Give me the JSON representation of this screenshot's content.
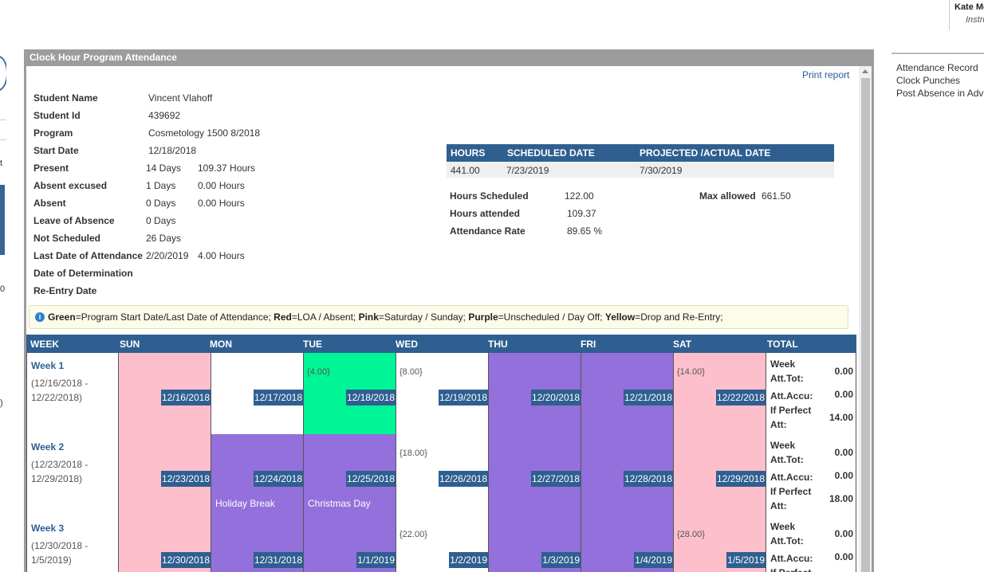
{
  "user": {
    "name": "Kate Mc",
    "role": "Instru"
  },
  "left_chars": [
    "t",
    "0",
    ")",
    "0"
  ],
  "panel": {
    "title": "Clock Hour Program Attendance",
    "print_label": "Print report"
  },
  "student": {
    "rows": [
      {
        "label": "Student Name",
        "value": "Vincent Vlahoff"
      },
      {
        "label": "Student Id",
        "value": "439692"
      },
      {
        "label": "Program",
        "value": "Cosmetology 1500 8/2018"
      },
      {
        "label": "Start Date",
        "value": "12/18/2018"
      },
      {
        "label": "Present",
        "days": "14 Days",
        "hours": "109.37 Hours"
      },
      {
        "label": "Absent excused",
        "days": "1 Days",
        "hours": "0.00 Hours"
      },
      {
        "label": "Absent",
        "days": "0 Days",
        "hours": "0.00 Hours"
      },
      {
        "label": "Leave of Absence",
        "days": "0 Days"
      },
      {
        "label": "Not Scheduled",
        "days": "26 Days"
      },
      {
        "label": "Last Date of Attendance",
        "value": "2/20/2019",
        "hours": "4.00 Hours"
      },
      {
        "label": "Date of Determination"
      },
      {
        "label": "Re-Entry Date"
      }
    ]
  },
  "projection": {
    "headers": [
      "HOURS",
      "SCHEDULED DATE",
      "PROJECTED /ACTUAL DATE"
    ],
    "row": [
      "441.00",
      "7/23/2019",
      "7/30/2019"
    ]
  },
  "stats": {
    "hours_scheduled_label": "Hours Scheduled",
    "hours_scheduled": "122.00",
    "hours_attended_label": "Hours attended",
    "hours_attended": "109.37",
    "attendance_rate_label": "Attendance Rate",
    "attendance_rate": "89.65 %",
    "max_allowed_label": "Max allowed",
    "max_allowed": "661.50"
  },
  "legend": {
    "parts": [
      {
        "b": "Green",
        "t": "=Program Start Date/Last Date of Attendance; "
      },
      {
        "b": "Red",
        "t": "=LOA / Absent; "
      },
      {
        "b": "Pink",
        "t": "=Saturday / Sunday; "
      },
      {
        "b": "Purple",
        "t": "=Unscheduled / Day Off; "
      },
      {
        "b": "Yellow",
        "t": "=Drop and Re-Entry;"
      }
    ]
  },
  "calendar": {
    "headers": [
      "WEEK",
      "SUN",
      "MON",
      "TUE",
      "WED",
      "THU",
      "FRI",
      "SAT",
      "TOTAL"
    ],
    "total_labels": [
      "Week",
      "Att.Tot:",
      "Att.Accu:",
      "If Perfect",
      "Att:"
    ],
    "weeks": [
      {
        "name": "Week 1",
        "range": "(12/16/2018 -\n12/22/2018)",
        "days": [
          {
            "date": "12/16/2018",
            "color": "pink"
          },
          {
            "date": "12/17/2018",
            "color": "white"
          },
          {
            "date": "12/18/2018",
            "color": "green",
            "hours": "{4.00}"
          },
          {
            "date": "12/19/2018",
            "color": "white",
            "hours": "{8.00}"
          },
          {
            "date": "12/20/2018",
            "color": "purple"
          },
          {
            "date": "12/21/2018",
            "color": "purple"
          },
          {
            "date": "12/22/2018",
            "color": "pink",
            "hours": "{14.00}"
          }
        ],
        "week_att_tot": "0.00",
        "att_accu": "0.00",
        "if_perfect": "14.00"
      },
      {
        "name": "Week 2",
        "range": "(12/23/2018 -\n12/29/2018)",
        "days": [
          {
            "date": "12/23/2018",
            "color": "pink"
          },
          {
            "date": "12/24/2018",
            "color": "purple",
            "event": "Holiday Break"
          },
          {
            "date": "12/25/2018",
            "color": "purple",
            "event": "Christmas Day"
          },
          {
            "date": "12/26/2018",
            "color": "white",
            "hours": "{18.00}"
          },
          {
            "date": "12/27/2018",
            "color": "purple"
          },
          {
            "date": "12/28/2018",
            "color": "purple"
          },
          {
            "date": "12/29/2018",
            "color": "pink"
          }
        ],
        "week_att_tot": "0.00",
        "att_accu": "0.00",
        "if_perfect": "18.00"
      },
      {
        "name": "Week 3",
        "range": "(12/30/2018 -\n1/5/2019)",
        "days": [
          {
            "date": "12/30/2018",
            "color": "pink"
          },
          {
            "date": "12/31/2018",
            "color": "purple"
          },
          {
            "date": "1/1/2019",
            "color": "purple"
          },
          {
            "date": "1/2/2019",
            "color": "white",
            "hours": "{22.00}"
          },
          {
            "date": "1/3/2019",
            "color": "purple"
          },
          {
            "date": "1/4/2019",
            "color": "purple"
          },
          {
            "date": "1/5/2019",
            "color": "pink",
            "hours": "{28.00}"
          }
        ],
        "week_att_tot": "0.00",
        "att_accu": "0.00",
        "if_perfect": ""
      }
    ]
  },
  "sidebar": {
    "links": [
      "Attendance Record",
      "Clock Punches",
      "Post Absence in Advance"
    ]
  }
}
